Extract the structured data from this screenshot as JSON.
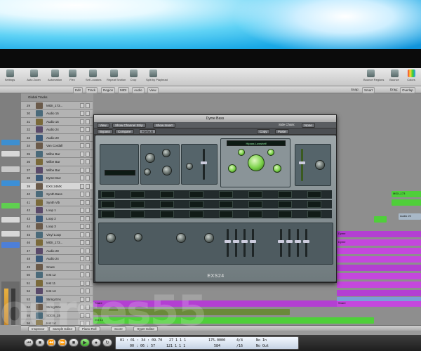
{
  "toolbar": {
    "buttons": [
      "Settings",
      "Auto Zoom",
      "Automation",
      "Flex",
      "Set Locators",
      "Repeat Section",
      "Crop",
      "Split by Playhead"
    ],
    "right_buttons": [
      "Bounce Regions",
      "Bounce",
      "Colors"
    ]
  },
  "menubar": {
    "items": [
      "Edit",
      "Track",
      "Region",
      "MIDI",
      "Audio",
      "View"
    ],
    "right_items": [
      "Snap:",
      "Smart",
      "Drag:",
      "Overlap"
    ]
  },
  "global_tracks_label": "Global Tracks",
  "tracks": [
    {
      "num": "29",
      "name": "MIDI_173..."
    },
    {
      "num": "30",
      "name": "Audio 15"
    },
    {
      "num": "31",
      "name": "Audio 15"
    },
    {
      "num": "32",
      "name": "Audio 24"
    },
    {
      "num": "33",
      "name": "Audio 20"
    },
    {
      "num": "34",
      "name": "Van Cordall"
    },
    {
      "num": "35",
      "name": "Wilbe Bar"
    },
    {
      "num": "36",
      "name": "Wilbe Bar"
    },
    {
      "num": "37",
      "name": "Wilbe Bar"
    },
    {
      "num": "38",
      "name": "Dyme Buz"
    },
    {
      "num": "39",
      "name": "EXS 24MX"
    },
    {
      "num": "40",
      "name": "Synth Bass"
    },
    {
      "num": "41",
      "name": "Synth Vib"
    },
    {
      "num": "42",
      "name": "Loop 1"
    },
    {
      "num": "43",
      "name": "Loop 2"
    },
    {
      "num": "44",
      "name": "Loop 3"
    },
    {
      "num": "45",
      "name": "Vinyl Loop"
    },
    {
      "num": "46",
      "name": "MIDI_173..."
    },
    {
      "num": "47",
      "name": "Audio 28"
    },
    {
      "num": "48",
      "name": "Audio 24"
    },
    {
      "num": "49",
      "name": "Snare"
    },
    {
      "num": "50",
      "name": "Inst 12"
    },
    {
      "num": "51",
      "name": "Inst 11"
    },
    {
      "num": "52",
      "name": "Inst 13"
    },
    {
      "num": "53",
      "name": "String Ens"
    },
    {
      "num": "54",
      "name": "String Ens"
    },
    {
      "num": "55",
      "name": "SDDS_15"
    },
    {
      "num": "56",
      "name": "Inst 14"
    }
  ],
  "plugin": {
    "title": "Dyme Bass",
    "view_label": "View",
    "show_channel_strip": "Show Channel Strip",
    "show_insert": "Show Insert",
    "side_chain_label": "Side Chain:",
    "side_chain_value": "None",
    "preset_label": "Compare",
    "bypass_label": "Bypass",
    "default_label": "#default",
    "copy_label": "Copy",
    "paste_label": "Paste",
    "filter_display": "Hipass Lowshelf",
    "name": "EXS24"
  },
  "arrange_regions": [
    "MIDI_173",
    "Audio 20",
    "Audio 28",
    "Audio 14",
    "Dyme",
    "Dyme",
    "Snare",
    "Snare",
    "Inst 13",
    "String Ens",
    "SDDS_15"
  ],
  "bottom_tabs": [
    "Inspector",
    "Sample Editor",
    "Piano Roll",
    "Score",
    "Hyper Editor"
  ],
  "transport": {
    "time": "01 : 01 : 34 : 09.70",
    "time2": "00 : 06 : 57",
    "bars": "27   1   1   1",
    "bars2": "121   1   1   1",
    "tempo": "175.0000",
    "tempo2": "584",
    "signature": "4/4",
    "division": "/16",
    "in": "No In",
    "out": "No Out"
  },
  "watermark": "ourses55",
  "colors": {
    "region_green": "#4fcf3a",
    "region_purple": "#b33fd2",
    "region_blue": "#7a9ed8",
    "region_orange": "#d98a2b",
    "region_olive": "#8a9a3a"
  }
}
